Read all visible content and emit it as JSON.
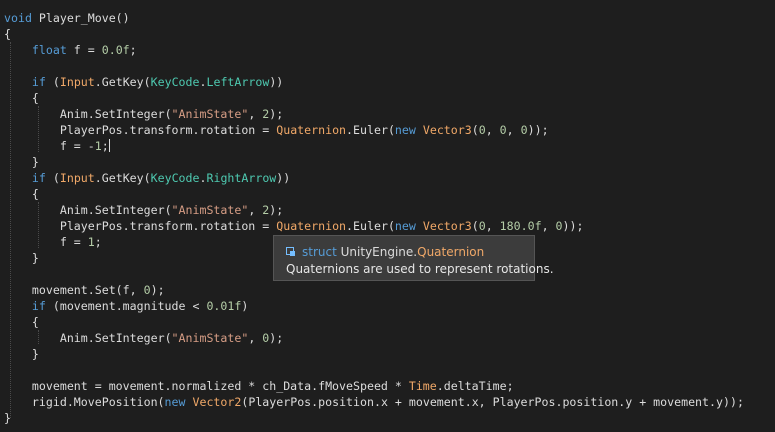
{
  "code_lines": [
    [
      [
        "kw",
        "void"
      ],
      [
        "id",
        " Player_Move()"
      ]
    ],
    [
      [
        "punc",
        "{"
      ]
    ],
    [
      [
        "id",
        "    "
      ],
      [
        "kw",
        "float"
      ],
      [
        "id",
        " f = "
      ],
      [
        "num",
        "0.0f"
      ],
      [
        "punc",
        ";"
      ]
    ],
    [],
    [
      [
        "id",
        "    "
      ],
      [
        "kw",
        "if"
      ],
      [
        "id",
        " ("
      ],
      [
        "cls",
        "Input"
      ],
      [
        "id",
        "."
      ],
      [
        "method",
        "GetKey"
      ],
      [
        "id",
        "("
      ],
      [
        "type",
        "KeyCode"
      ],
      [
        "id",
        "."
      ],
      [
        "type",
        "LeftArrow"
      ],
      [
        "id",
        "))"
      ]
    ],
    [
      [
        "id",
        "    {"
      ]
    ],
    [
      [
        "id",
        "        Anim."
      ],
      [
        "method",
        "SetInteger"
      ],
      [
        "id",
        "("
      ],
      [
        "str",
        "\"AnimState\""
      ],
      [
        "id",
        ", "
      ],
      [
        "num",
        "2"
      ],
      [
        "id",
        ");"
      ]
    ],
    [
      [
        "id",
        "        PlayerPos.transform.rotation = "
      ],
      [
        "cls",
        "Quaternion"
      ],
      [
        "id",
        "."
      ],
      [
        "method",
        "Euler"
      ],
      [
        "id",
        "("
      ],
      [
        "kw",
        "new"
      ],
      [
        "id",
        " "
      ],
      [
        "cls",
        "Vector3"
      ],
      [
        "id",
        "("
      ],
      [
        "num",
        "0"
      ],
      [
        "id",
        ", "
      ],
      [
        "num",
        "0"
      ],
      [
        "id",
        ", "
      ],
      [
        "num",
        "0"
      ],
      [
        "id",
        "));"
      ]
    ],
    [
      [
        "id",
        "        f = -"
      ],
      [
        "num",
        "1"
      ],
      [
        "id",
        ";"
      ],
      [
        "cursor",
        ""
      ]
    ],
    [
      [
        "id",
        "    }"
      ]
    ],
    [
      [
        "id",
        "    "
      ],
      [
        "kw",
        "if"
      ],
      [
        "id",
        " ("
      ],
      [
        "cls",
        "Input"
      ],
      [
        "id",
        "."
      ],
      [
        "method",
        "GetKey"
      ],
      [
        "id",
        "("
      ],
      [
        "type",
        "KeyCode"
      ],
      [
        "id",
        "."
      ],
      [
        "type",
        "RightArrow"
      ],
      [
        "id",
        "))"
      ]
    ],
    [
      [
        "id",
        "    {"
      ]
    ],
    [
      [
        "id",
        "        Anim."
      ],
      [
        "method",
        "SetInteger"
      ],
      [
        "id",
        "("
      ],
      [
        "str",
        "\"AnimState\""
      ],
      [
        "id",
        ", "
      ],
      [
        "num",
        "2"
      ],
      [
        "id",
        ");"
      ]
    ],
    [
      [
        "id",
        "        PlayerPos.transform.rotation = "
      ],
      [
        "cls",
        "Quaternion"
      ],
      [
        "id",
        "."
      ],
      [
        "method",
        "Euler"
      ],
      [
        "id",
        "("
      ],
      [
        "kw",
        "new"
      ],
      [
        "id",
        " "
      ],
      [
        "cls",
        "Vector3"
      ],
      [
        "id",
        "("
      ],
      [
        "num",
        "0"
      ],
      [
        "id",
        ", "
      ],
      [
        "num",
        "180.0f"
      ],
      [
        "id",
        ", "
      ],
      [
        "num",
        "0"
      ],
      [
        "id",
        "));"
      ]
    ],
    [
      [
        "id",
        "        f = "
      ],
      [
        "num",
        "1"
      ],
      [
        "id",
        ";"
      ]
    ],
    [
      [
        "id",
        "    }"
      ]
    ],
    [],
    [
      [
        "id",
        "    movement.Set(f, "
      ],
      [
        "num",
        "0"
      ],
      [
        "id",
        ");"
      ]
    ],
    [
      [
        "id",
        "    "
      ],
      [
        "kw",
        "if"
      ],
      [
        "id",
        " (movement.magnitude < "
      ],
      [
        "num",
        "0.01f"
      ],
      [
        "id",
        ")"
      ]
    ],
    [
      [
        "id",
        "    {"
      ]
    ],
    [
      [
        "id",
        "        Anim."
      ],
      [
        "method",
        "SetInteger"
      ],
      [
        "id",
        "("
      ],
      [
        "str",
        "\"AnimState\""
      ],
      [
        "id",
        ", "
      ],
      [
        "num",
        "0"
      ],
      [
        "id",
        ");"
      ]
    ],
    [
      [
        "id",
        "    }"
      ]
    ],
    [],
    [
      [
        "id",
        "    movement = movement.normalized * ch_Data.fMoveSpeed * "
      ],
      [
        "cls",
        "Time"
      ],
      [
        "id",
        ".deltaTime;"
      ]
    ],
    [
      [
        "id",
        "    rigid.MovePosition("
      ],
      [
        "kw",
        "new"
      ],
      [
        "id",
        " "
      ],
      [
        "cls",
        "Vector2"
      ],
      [
        "id",
        "(PlayerPos.position.x + movement.x, PlayerPos.position.y + movement.y));"
      ]
    ],
    [
      [
        "punc",
        "}"
      ]
    ]
  ],
  "tooltip": {
    "icon": "struct-icon",
    "keyword": "struct",
    "namespace": "UnityEngine.",
    "type_name": "Quaternion",
    "description": "Quaternions are used to represent rotations."
  },
  "colors": {
    "background": "#1e1e1e",
    "keyword": "#569cd6",
    "type": "#4ec9b0",
    "class": "#f0a868",
    "string": "#d69d85",
    "number": "#b5cea8",
    "text": "#dcdcdc"
  }
}
